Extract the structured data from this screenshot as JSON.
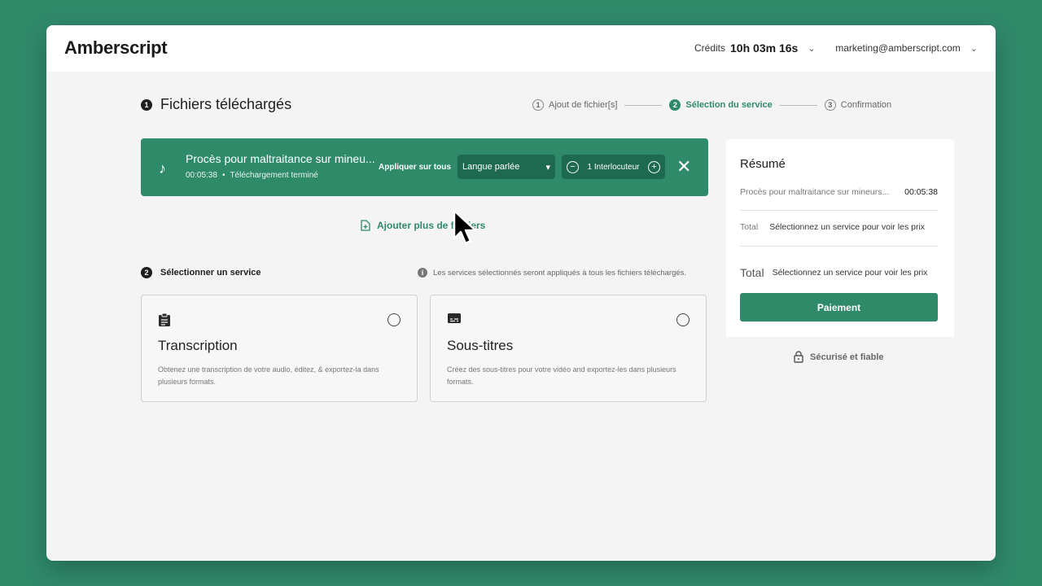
{
  "header": {
    "logo": "Amberscript",
    "credits_label": "Crédits",
    "credits_value": "10h 03m 16s",
    "account_email": "marketing@amberscript.com"
  },
  "page": {
    "step_number": "1",
    "title": "Fichiers téléchargés"
  },
  "stepper": [
    {
      "num": "1",
      "label": "Ajout de fichier[s]"
    },
    {
      "num": "2",
      "label": "Sélection du service"
    },
    {
      "num": "3",
      "label": "Confirmation"
    }
  ],
  "file": {
    "name": "Procès pour maltraitance sur mineu...",
    "duration": "00:05:38",
    "status": "Téléchargement terminé",
    "apply_all": "Appliquer sur tous",
    "language_placeholder": "Langue parlée",
    "speakers": "1 Interlocuteur"
  },
  "add_more": "Ajouter plus de fichiers",
  "services": {
    "step_number": "2",
    "heading": "Sélectionner un service",
    "note": "Les services sélectionnés seront appliqués à tous les fichiers téléchargés.",
    "cards": [
      {
        "title": "Transcription",
        "desc": "Obtenez une transcription de votre audio, éditez, & exportez-la dans plusieurs formats."
      },
      {
        "title": "Sous-titres",
        "desc": "Créez des sous-titres pour votre vidéo and exportez-les dans plusieurs formats."
      }
    ]
  },
  "summary": {
    "title": "Résumé",
    "file_name": "Procès pour maltraitance sur mineurs...",
    "file_duration": "00:05:38",
    "total_label": "Total",
    "total_text": "Sélectionnez un service pour voir les prix",
    "grand_total_label": "Total",
    "grand_total_text": "Sélectionnez un service pour voir les prix",
    "pay_button": "Paiement"
  },
  "secure": "Sécurisé et fiable",
  "colors": {
    "brand": "#2f8a6a",
    "brand_dark": "#1d6a50",
    "background": "#f4f4f4"
  },
  "icons": [
    "music-note-icon",
    "close-icon",
    "add-file-icon",
    "info-icon",
    "clipboard-icon",
    "subtitles-icon",
    "lock-icon",
    "chevron-down-icon",
    "minus-icon",
    "plus-icon",
    "cursor-icon"
  ]
}
